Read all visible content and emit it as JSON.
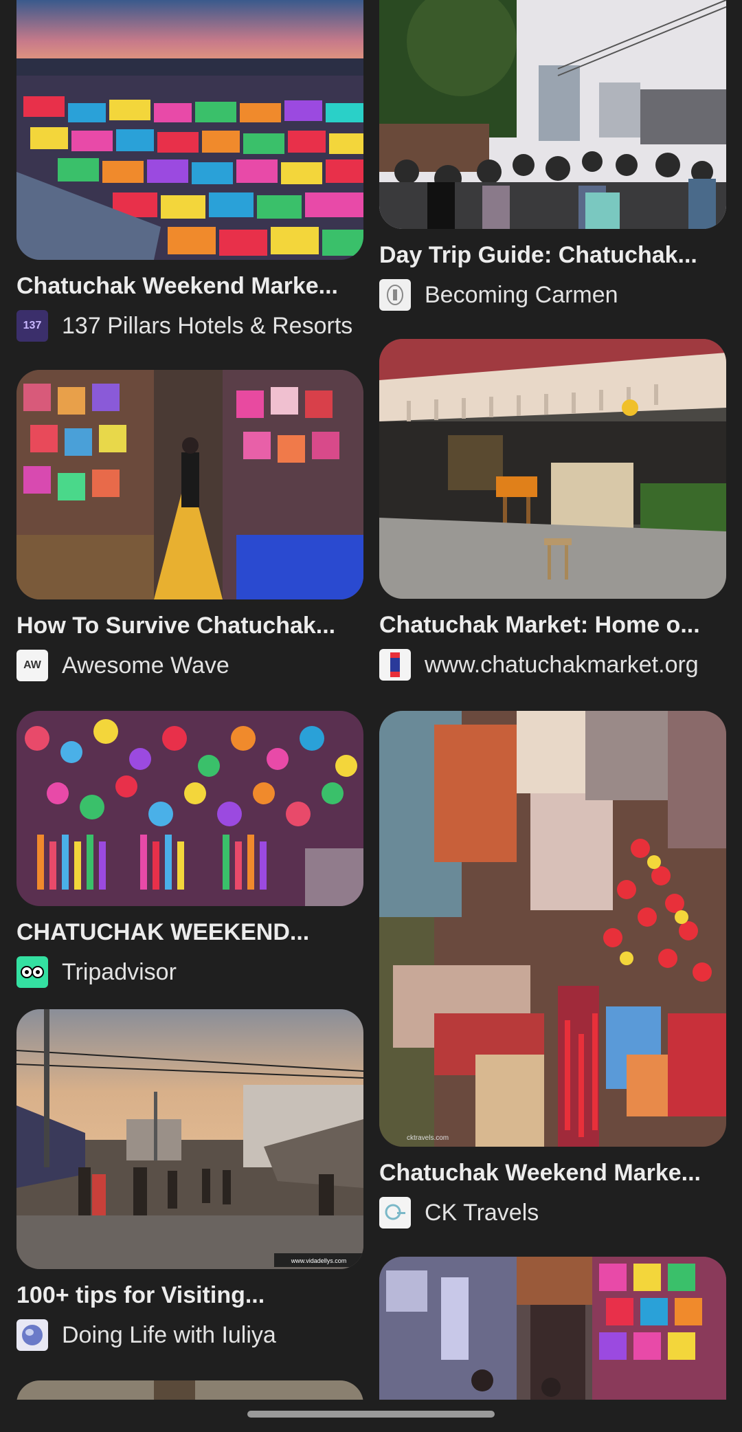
{
  "results": {
    "left": [
      {
        "title": "Chatuchak Weekend Marke...",
        "source": "137 Pillars Hotels & Resorts",
        "favicon": "137",
        "favicon_icon": "hotel-logo-icon"
      },
      {
        "title": "How To Survive Chatuchak...",
        "source": "Awesome Wave",
        "favicon": "AW",
        "favicon_icon": "awesome-wave-logo-icon"
      },
      {
        "title": "CHATUCHAK WEEKEND...",
        "source": "Tripadvisor",
        "favicon": "",
        "favicon_icon": "tripadvisor-owl-icon"
      },
      {
        "title": "100+ tips for Visiting...",
        "source": "Doing Life with Iuliya",
        "favicon": "",
        "favicon_icon": "globe-logo-icon"
      }
    ],
    "right": [
      {
        "title": "Day Trip Guide: Chatuchak...",
        "source": "Becoming Carmen",
        "favicon": "",
        "favicon_icon": "becoming-carmen-logo-icon"
      },
      {
        "title": "Chatuchak Market: Home o...",
        "source": "www.chatuchakmarket.org",
        "favicon": "",
        "favicon_icon": "thai-flag-icon"
      },
      {
        "title": "Chatuchak Weekend Marke...",
        "source": "CK Travels",
        "favicon": "",
        "favicon_icon": "ck-travels-logo-icon"
      }
    ]
  },
  "watermarks": {
    "vidadellys": "www.vidadellys.com",
    "cktravels": "cktravels.com"
  }
}
